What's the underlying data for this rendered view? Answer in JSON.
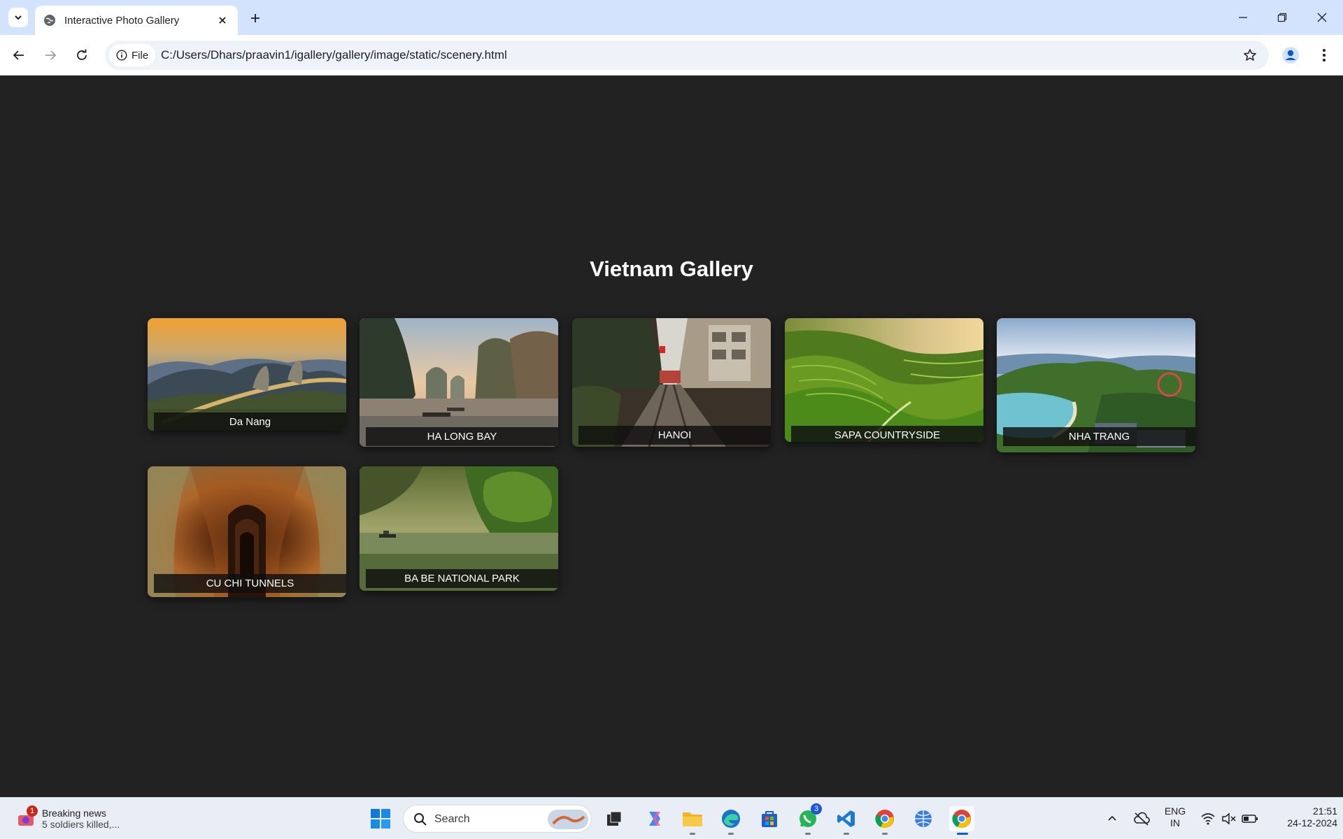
{
  "browser": {
    "tab_title": "Interactive Photo Gallery",
    "site_chip_label": "File",
    "url": "C:/Users/Dhars/praavin1/igallery/gallery/image/static/scenery.html"
  },
  "page": {
    "title": "Vietnam Gallery",
    "cards": [
      {
        "caption": "Da Nang",
        "image": "golden-bridge-hands-sunset"
      },
      {
        "caption": "HA LONG BAY",
        "image": "limestone-karsts-bay"
      },
      {
        "caption": "HANOI",
        "image": "train-street"
      },
      {
        "caption": "SAPA COUNTRYSIDE",
        "image": "rice-terraces"
      },
      {
        "caption": "NHA TRANG",
        "image": "coastal-bay-ferris-wheel"
      },
      {
        "caption": "CU CHI TUNNELS",
        "image": "tunnel-passage"
      },
      {
        "caption": "BA BE NATIONAL PARK",
        "image": "river-with-boat"
      }
    ]
  },
  "taskbar": {
    "news_title": "Breaking news",
    "news_subtitle": "5 soldiers killed,...",
    "news_badge": "1",
    "search_placeholder": "Search",
    "whatsapp_badge": "3",
    "language_line1": "ENG",
    "language_line2": "IN",
    "time": "21:51",
    "date": "24-12-2024"
  },
  "colors": {
    "page_background": "#222222",
    "tabbar": "#d3e3fd",
    "caption_bar": "#0f0f0f"
  }
}
